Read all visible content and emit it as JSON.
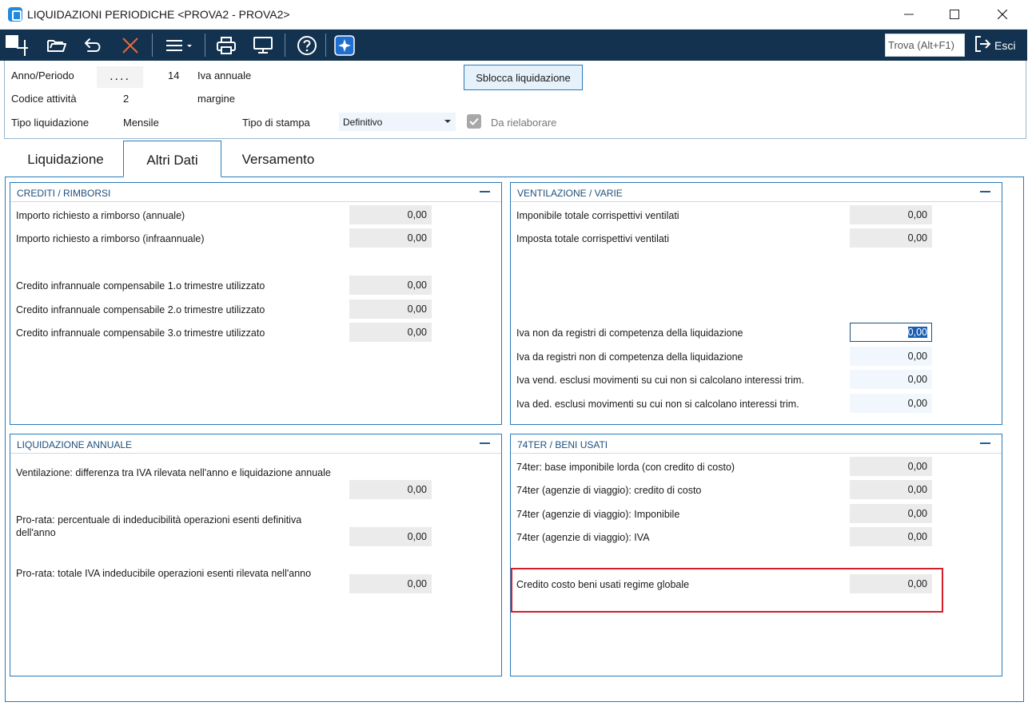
{
  "window": {
    "title": "LIQUIDAZIONI PERIODICHE <PROVA2 - PROVA2>",
    "minimize_icon": "minimize-icon",
    "maximize_icon": "maximize-icon",
    "close_icon": "close-icon"
  },
  "toolbar": {
    "icons": [
      "new-icon",
      "open-folder-icon",
      "undo-icon",
      "delete-icon",
      "menu-icon",
      "print-icon",
      "monitor-icon",
      "help-icon",
      "ai-sparkle-icon"
    ],
    "search_placeholder": "Trova (Alt+F1)",
    "exit_label": "Esci"
  },
  "header": {
    "anno_periodo_label": "Anno/Periodo",
    "anno_periodo_value": "....",
    "period_number": "14",
    "iva_annuale_label": "Iva annuale",
    "codice_attivita_label": "Codice attività",
    "codice_attivita_value": "2",
    "margine_label": "margine",
    "tipo_liquidazione_label": "Tipo liquidazione",
    "tipo_liquidazione_value": "Mensile",
    "tipo_stampa_label": "Tipo di stampa",
    "tipo_stampa_value": "Definitivo",
    "da_rielaborare_label": "Da rielaborare",
    "da_rielaborare_checked": true,
    "unlock_button": "Sblocca liquidazione"
  },
  "tabs": [
    {
      "label": "Liquidazione",
      "active": false
    },
    {
      "label": "Altri Dati",
      "active": true
    },
    {
      "label": "Versamento",
      "active": false
    }
  ],
  "crediti": {
    "title": "CREDITI / RIMBORSI",
    "rows": [
      {
        "label": "Importo richiesto a rimborso (annuale)",
        "value": "0,00"
      },
      {
        "label": "Importo richiesto a rimborso (infraannuale)",
        "value": "0,00"
      },
      {
        "label": "Credito  infrannuale compensabile 1.o trimestre utilizzato",
        "value": "0,00"
      },
      {
        "label": "Credito  infrannuale compensabile 2.o trimestre utilizzato",
        "value": "0,00"
      },
      {
        "label": "Credito  infrannuale compensabile 3.o trimestre utilizzato",
        "value": "0,00"
      }
    ]
  },
  "ventilazione": {
    "title": "VENTILAZIONE / VARIE",
    "rows": [
      {
        "label": "Imponibile totale corrispettivi ventilati",
        "value": "0,00"
      },
      {
        "label": "Imposta totale corrispettivi ventilati",
        "value": "0,00"
      },
      {
        "label": "Iva non da  registri  di competenza della liquidazione",
        "value": "0,00"
      },
      {
        "label": "Iva da registri non di competenza della liquidazione",
        "value": "0,00"
      },
      {
        "label": "Iva vend. esclusi movimenti su cui non si calcolano interessi trim.",
        "value": "0,00"
      },
      {
        "label": "Iva ded. esclusi movimenti su cui non si calcolano interessi trim.",
        "value": "0,00"
      }
    ]
  },
  "liquidazione_annuale": {
    "title": "LIQUIDAZIONE ANNUALE",
    "rows": [
      {
        "label": "Ventilazione: differenza tra IVA rilevata nell'anno e liquidazione annuale",
        "value": "0,00"
      },
      {
        "label": "Pro-rata: percentuale di indeducibilità operazioni esenti definitiva dell'anno",
        "value": "0,00"
      },
      {
        "label": "Pro-rata: totale IVA indeducibile operazioni esenti rilevata nell'anno",
        "value": "0,00"
      }
    ]
  },
  "beni_usati": {
    "title": "74TER / BENI USATI",
    "rows": [
      {
        "label": "74ter: base imponibile lorda (con credito di costo)",
        "value": "0,00"
      },
      {
        "label": "74ter (agenzie di viaggio): credito di costo",
        "value": "0,00"
      },
      {
        "label": "74ter (agenzie di viaggio): Imponibile",
        "value": "0,00"
      },
      {
        "label": "74ter (agenzie di viaggio): IVA",
        "value": "0,00"
      },
      {
        "label": "Credito costo beni usati regime globale",
        "value": "0,00"
      }
    ]
  }
}
